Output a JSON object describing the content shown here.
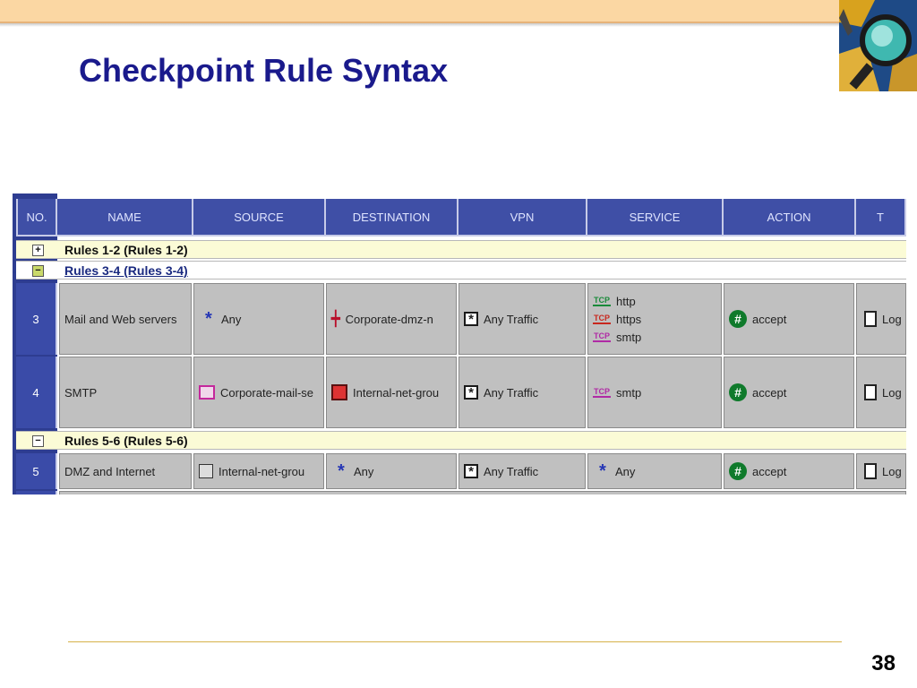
{
  "slide": {
    "title": "Checkpoint Rule Syntax",
    "page_number": "38"
  },
  "table": {
    "columns": [
      "NO.",
      "NAME",
      "SOURCE",
      "DESTINATION",
      "VPN",
      "SERVICE",
      "ACTION",
      "T"
    ],
    "groups": [
      {
        "toggle": "+",
        "label": "Rules 1-2   (Rules 1-2)"
      },
      {
        "toggle": "−",
        "label": "Rules 3-4   (Rules 3-4)"
      },
      {
        "toggle": "−",
        "label": "Rules 5-6   (Rules 5-6)"
      }
    ],
    "rows": [
      {
        "no": "3",
        "name": "Mail and Web servers",
        "source": {
          "icon": "any-star-icon",
          "text": "Any"
        },
        "destination": {
          "icon": "dmz-network-icon",
          "text": "Corporate-dmz-n"
        },
        "vpn": {
          "icon": "any-traffic-icon",
          "text": "Any Traffic"
        },
        "services": [
          {
            "proto": "TCP",
            "color": "#1a8a3a",
            "name": "http"
          },
          {
            "proto": "TCP",
            "color": "#c8281e",
            "name": "https"
          },
          {
            "proto": "TCP",
            "color": "#b02aa5",
            "name": "smtp"
          }
        ],
        "action": {
          "icon": "accept-icon",
          "text": "accept"
        },
        "track": "Log"
      },
      {
        "no": "4",
        "name": "SMTP",
        "source": {
          "icon": "mail-server-icon",
          "text": "Corporate-mail-se"
        },
        "destination": {
          "icon": "network-group-icon",
          "text": "Internal-net-grou"
        },
        "vpn": {
          "icon": "any-traffic-icon",
          "text": "Any Traffic"
        },
        "services": [
          {
            "proto": "TCP",
            "color": "#b02aa5",
            "name": "smtp"
          }
        ],
        "action": {
          "icon": "accept-icon",
          "text": "accept"
        },
        "track": "Log"
      },
      {
        "no": "5",
        "name": "DMZ and Internet",
        "source": {
          "icon": "building-icon",
          "text": "Internal-net-grou"
        },
        "destination": {
          "icon": "any-star-icon",
          "text": "Any"
        },
        "vpn": {
          "icon": "any-traffic-icon",
          "text": "Any Traffic"
        },
        "services": [
          {
            "proto": "",
            "color": "#2536b5",
            "name": "Any"
          }
        ],
        "action": {
          "icon": "accept-icon",
          "text": "accept"
        },
        "track": "Log"
      }
    ]
  }
}
